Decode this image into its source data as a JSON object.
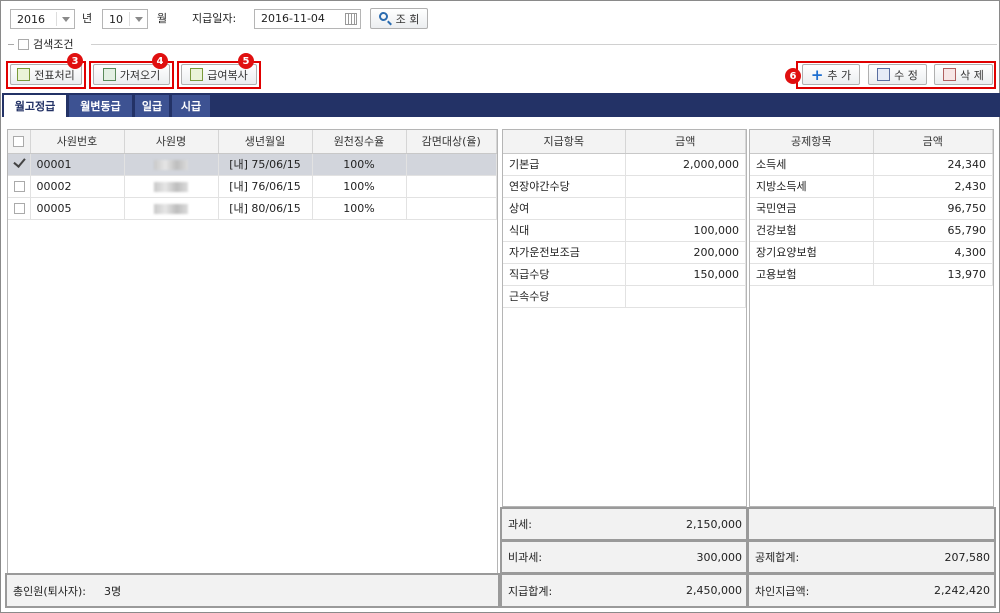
{
  "search": {
    "year": "2016",
    "year_suffix": "년",
    "month": "10",
    "month_suffix": "월",
    "pay_date_label": "지급일자:",
    "pay_date": "2016-11-04",
    "search_button": "조 회",
    "condition_label": "검색조건"
  },
  "toolbar": {
    "voucher": "전표처리",
    "import": "가져오기",
    "copy": "급여복사",
    "add": "추 가",
    "edit": "수 정",
    "delete": "삭 제",
    "badges": [
      "3",
      "4",
      "5",
      "6"
    ]
  },
  "tabs": [
    "월고정급",
    "월변동급",
    "일급",
    "시급"
  ],
  "employees": {
    "headers": [
      "사원번호",
      "사원명",
      "생년월일",
      "원천징수율",
      "감면대상(율)"
    ],
    "rows": [
      {
        "id": "00001",
        "birth": "[내] 75/06/15",
        "rate": "100%",
        "checked": true
      },
      {
        "id": "00002",
        "birth": "[내] 76/06/15",
        "rate": "100%",
        "checked": false
      },
      {
        "id": "00005",
        "birth": "[내] 80/06/15",
        "rate": "100%",
        "checked": false
      }
    ],
    "total_label": "총인원(퇴사자):",
    "total_value": "3명"
  },
  "payments": {
    "headers": [
      "지급항목",
      "금액"
    ],
    "rows": [
      {
        "item": "기본급",
        "amount": "2,000,000"
      },
      {
        "item": "연장야간수당",
        "amount": ""
      },
      {
        "item": "상여",
        "amount": ""
      },
      {
        "item": "식대",
        "amount": "100,000"
      },
      {
        "item": "자가운전보조금",
        "amount": "200,000"
      },
      {
        "item": "직급수당",
        "amount": "150,000"
      },
      {
        "item": "근속수당",
        "amount": ""
      }
    ],
    "taxable_label": "과세:",
    "taxable_value": "2,150,000",
    "nontaxable_label": "비과세:",
    "nontaxable_value": "300,000",
    "total_label": "지급합계:",
    "total_value": "2,450,000"
  },
  "deductions": {
    "headers": [
      "공제항목",
      "금액"
    ],
    "rows": [
      {
        "item": "소득세",
        "amount": "24,340"
      },
      {
        "item": "지방소득세",
        "amount": "2,430"
      },
      {
        "item": "국민연금",
        "amount": "96,750"
      },
      {
        "item": "건강보험",
        "amount": "65,790"
      },
      {
        "item": "장기요양보험",
        "amount": "4,300"
      },
      {
        "item": "고용보험",
        "amount": "13,970"
      }
    ],
    "total_label": "공제합계:",
    "total_value": "207,580",
    "net_label": "차인지급액:",
    "net_value": "2,242,420"
  },
  "colors": {
    "accent": "#233266",
    "tab_inactive": "#3d5292",
    "highlight": "#e00000",
    "selected_row": "#d2d5dc"
  }
}
